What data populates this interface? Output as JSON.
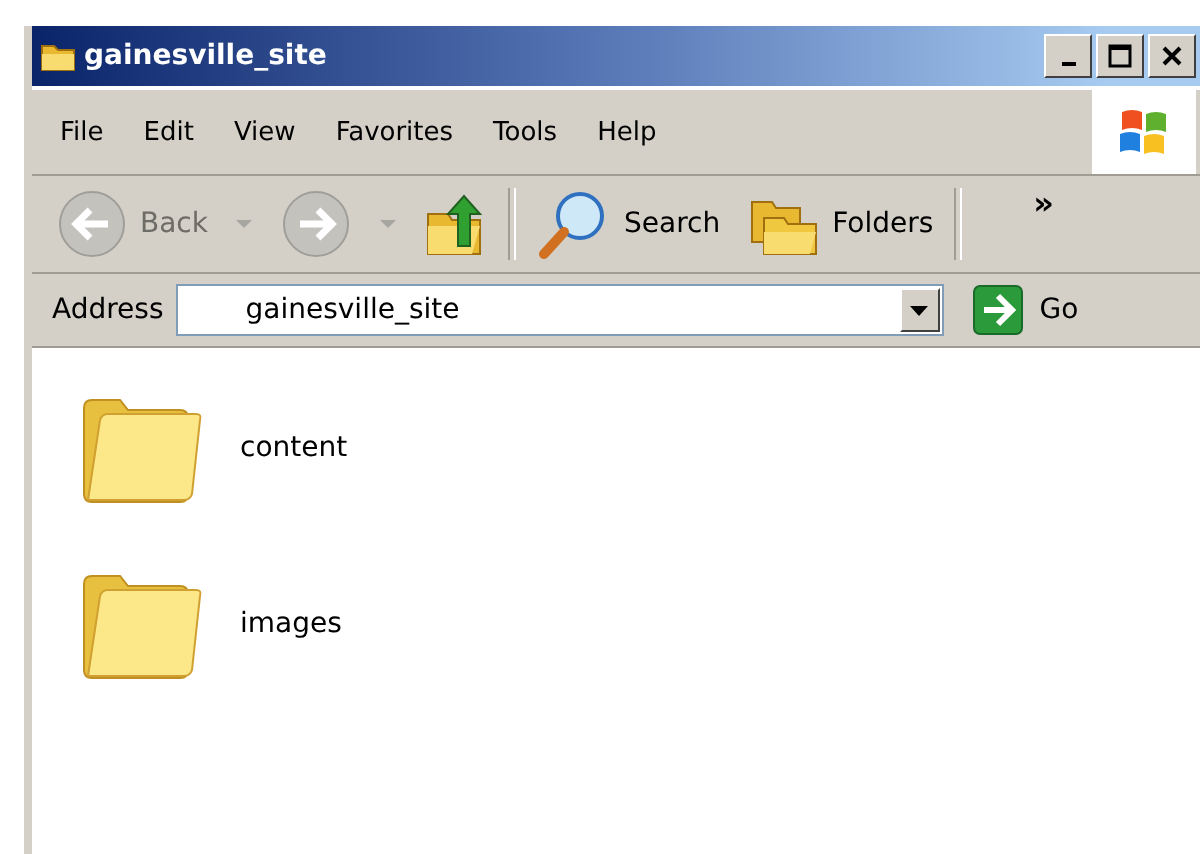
{
  "window": {
    "title": "gainesville_site"
  },
  "menu": [
    {
      "label": "File"
    },
    {
      "label": "Edit"
    },
    {
      "label": "View"
    },
    {
      "label": "Favorites"
    },
    {
      "label": "Tools"
    },
    {
      "label": "Help"
    }
  ],
  "toolbar": [
    {
      "kind": "back",
      "label": "Back",
      "disabled": true
    },
    {
      "kind": "forward",
      "disabled": true
    },
    {
      "kind": "up"
    },
    {
      "kind": "search",
      "label": "Search"
    },
    {
      "kind": "folders",
      "label": "Folders"
    }
  ],
  "chevron": "»",
  "address": {
    "label": "Address",
    "value": "gainesville_site",
    "go": "Go"
  },
  "items": [
    {
      "name": "content"
    },
    {
      "name": "images"
    }
  ]
}
